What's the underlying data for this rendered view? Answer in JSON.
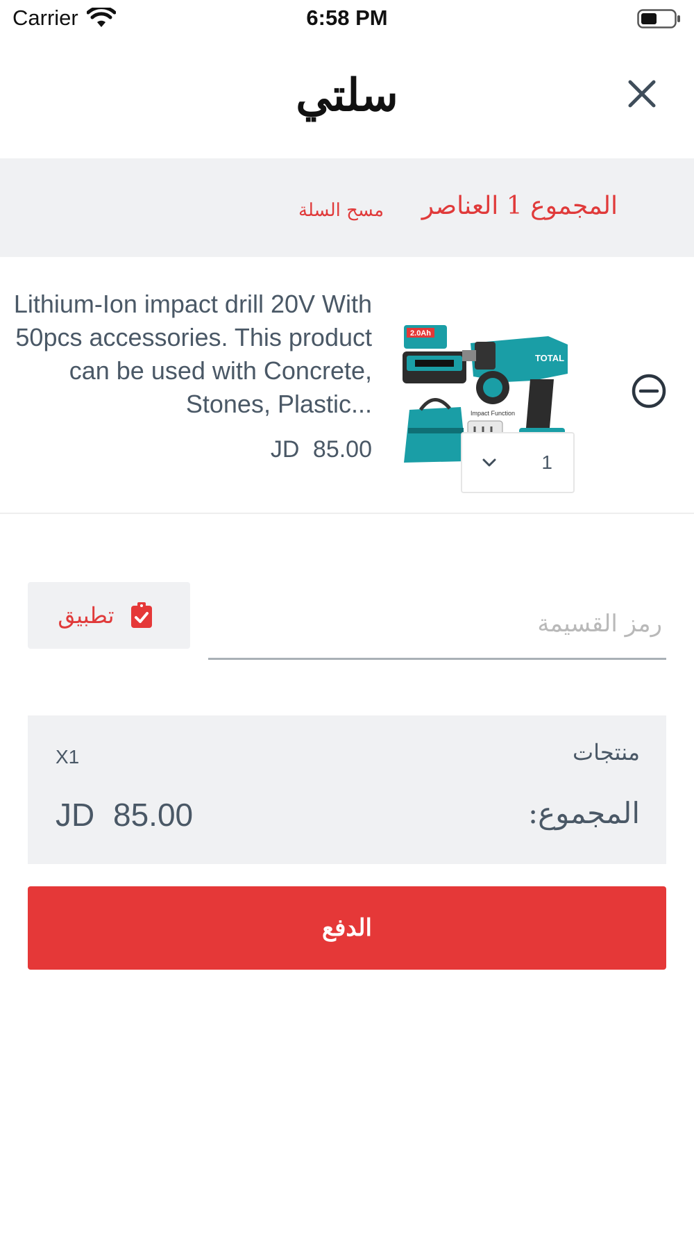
{
  "status_bar": {
    "carrier": "Carrier",
    "time": "6:58 PM",
    "icons": [
      "wifi-icon",
      "battery-icon"
    ]
  },
  "header": {
    "title": "سلتي",
    "close_icon": "close-icon"
  },
  "summary": {
    "total_items_label": "المجموع 1 العناصر",
    "clear_cart_label": "مسح السلة"
  },
  "cart_item": {
    "description": "Lithium-Ion impact drill 20V With 50pcs accessories. This product can be used with Concrete, Stones, Plastic...",
    "price": "JD 85.00",
    "quantity": "1",
    "remove_icon": "minus-circle-icon",
    "image_badge": "2.0Ah",
    "image_brand": "TOTAL",
    "image_caption": "Impact Function"
  },
  "coupon": {
    "placeholder": "رمز القسيمة",
    "value": "",
    "apply_label": "تطبيق",
    "apply_icon": "clipboard-check-icon"
  },
  "totals": {
    "products_label": "منتجات",
    "products_count": "X1",
    "sum_label": "المجموع:",
    "sum_value": "JD 85.00"
  },
  "checkout": {
    "label": "الدفع"
  },
  "colors": {
    "accent": "#e53838",
    "band": "#f0f1f3",
    "text_muted": "#4a5866",
    "product_teal": "#1a9ea6"
  }
}
